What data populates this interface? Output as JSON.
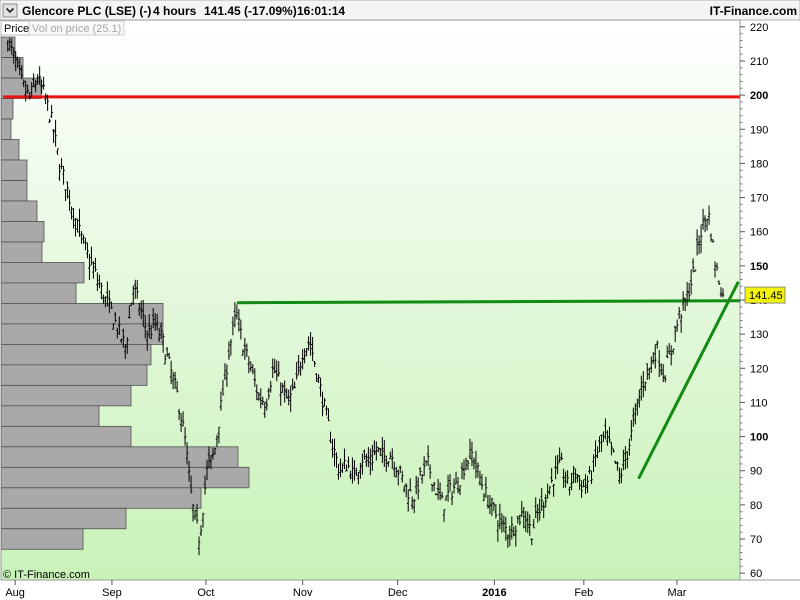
{
  "header": {
    "title": "Glencore PLC (LSE) (-)",
    "period": "4 hours",
    "quote": "141.45 (-17.09%)",
    "time": "16:01:14",
    "brand": "IT-Finance.com"
  },
  "legend": {
    "price_tab": "Price",
    "vol_tab": "Vol on price (25.1)"
  },
  "watermark": "© IT-Finance.com",
  "colors": {
    "plot_top": "#ffffff",
    "plot_bottom": "#c8f2b8",
    "resistance": "#ee1111",
    "support": "#138a13",
    "trend": "#138a13",
    "price_label_bg": "#f2f20a",
    "candle": "#000000",
    "volume_bar": "#a9a9a9"
  },
  "chart_data": {
    "type": "candlestick",
    "title": "Glencore PLC (LSE) (-)",
    "ylim": [
      58,
      222
    ],
    "yticks": [
      60,
      70,
      80,
      90,
      100,
      110,
      120,
      130,
      140,
      150,
      160,
      170,
      180,
      190,
      200,
      210,
      220
    ],
    "ytick_bold": [
      100,
      150,
      200
    ],
    "grid": false,
    "last_price": 141.45,
    "x_axis_labels": [
      {
        "label": "Aug",
        "bold": false
      },
      {
        "label": "Sep",
        "bold": false
      },
      {
        "label": "Oct",
        "bold": false
      },
      {
        "label": "Nov",
        "bold": false
      },
      {
        "label": "Dec",
        "bold": false
      },
      {
        "label": "2016",
        "bold": true
      },
      {
        "label": "Feb",
        "bold": false
      },
      {
        "label": "Mar",
        "bold": false
      }
    ],
    "series": [
      {
        "x": 0,
        "y": 216
      },
      {
        "x": 0.8,
        "y": 210
      },
      {
        "x": 1.6,
        "y": 203
      },
      {
        "x": 2.4,
        "y": 199
      },
      {
        "x": 3.2,
        "y": 205
      },
      {
        "x": 4,
        "y": 200
      },
      {
        "x": 4.8,
        "y": 192
      },
      {
        "x": 5.6,
        "y": 180
      },
      {
        "x": 6.4,
        "y": 173
      },
      {
        "x": 7.2,
        "y": 165
      },
      {
        "x": 8,
        "y": 158
      },
      {
        "x": 8.8,
        "y": 152
      },
      {
        "x": 9.6,
        "y": 147
      },
      {
        "x": 10.4,
        "y": 141
      },
      {
        "x": 11.2,
        "y": 137
      },
      {
        "x": 12,
        "y": 131
      },
      {
        "x": 12.8,
        "y": 126
      },
      {
        "x": 13.6,
        "y": 144
      },
      {
        "x": 14.4,
        "y": 137
      },
      {
        "x": 15.2,
        "y": 130
      },
      {
        "x": 16,
        "y": 133
      },
      {
        "x": 16.8,
        "y": 128
      },
      {
        "x": 17.6,
        "y": 120
      },
      {
        "x": 18.4,
        "y": 112
      },
      {
        "x": 19.2,
        "y": 100
      },
      {
        "x": 20,
        "y": 80
      },
      {
        "x": 20.8,
        "y": 70
      },
      {
        "x": 21.6,
        "y": 90
      },
      {
        "x": 22.4,
        "y": 95
      },
      {
        "x": 23.2,
        "y": 110
      },
      {
        "x": 24,
        "y": 125
      },
      {
        "x": 24.8,
        "y": 136
      },
      {
        "x": 25.6,
        "y": 126
      },
      {
        "x": 26.4,
        "y": 120
      },
      {
        "x": 27.2,
        "y": 112
      },
      {
        "x": 28,
        "y": 110
      },
      {
        "x": 28.8,
        "y": 120
      },
      {
        "x": 29.6,
        "y": 115
      },
      {
        "x": 30.4,
        "y": 110
      },
      {
        "x": 31.2,
        "y": 114
      },
      {
        "x": 32,
        "y": 125
      },
      {
        "x": 32.8,
        "y": 128
      },
      {
        "x": 33.6,
        "y": 118
      },
      {
        "x": 34.4,
        "y": 108
      },
      {
        "x": 35.2,
        "y": 98
      },
      {
        "x": 36,
        "y": 90
      },
      {
        "x": 36.8,
        "y": 92
      },
      {
        "x": 37.6,
        "y": 88
      },
      {
        "x": 38.4,
        "y": 94
      },
      {
        "x": 39.2,
        "y": 92
      },
      {
        "x": 40,
        "y": 96
      },
      {
        "x": 40.8,
        "y": 94
      },
      {
        "x": 41.6,
        "y": 95
      },
      {
        "x": 42.4,
        "y": 90
      },
      {
        "x": 43.2,
        "y": 85
      },
      {
        "x": 44,
        "y": 82
      },
      {
        "x": 44.8,
        "y": 88
      },
      {
        "x": 45.6,
        "y": 92
      },
      {
        "x": 46.4,
        "y": 85
      },
      {
        "x": 47.2,
        "y": 80
      },
      {
        "x": 48,
        "y": 84
      },
      {
        "x": 48.8,
        "y": 86
      },
      {
        "x": 49.6,
        "y": 92
      },
      {
        "x": 50.4,
        "y": 95
      },
      {
        "x": 51.2,
        "y": 88
      },
      {
        "x": 52,
        "y": 82
      },
      {
        "x": 52.8,
        "y": 78
      },
      {
        "x": 53.6,
        "y": 74
      },
      {
        "x": 54.4,
        "y": 72
      },
      {
        "x": 55.2,
        "y": 75
      },
      {
        "x": 56,
        "y": 78
      },
      {
        "x": 56.8,
        "y": 72
      },
      {
        "x": 57.6,
        "y": 78
      },
      {
        "x": 58.4,
        "y": 83
      },
      {
        "x": 59.2,
        "y": 88
      },
      {
        "x": 60,
        "y": 92
      },
      {
        "x": 60.8,
        "y": 85
      },
      {
        "x": 61.6,
        "y": 90
      },
      {
        "x": 62.4,
        "y": 85
      },
      {
        "x": 63.2,
        "y": 88
      },
      {
        "x": 64,
        "y": 96
      },
      {
        "x": 64.8,
        "y": 100
      },
      {
        "x": 65.6,
        "y": 95
      },
      {
        "x": 66.4,
        "y": 88
      },
      {
        "x": 67.2,
        "y": 95
      },
      {
        "x": 68,
        "y": 105
      },
      {
        "x": 68.8,
        "y": 115
      },
      {
        "x": 69.6,
        "y": 120
      },
      {
        "x": 70.4,
        "y": 126
      },
      {
        "x": 71.2,
        "y": 118
      },
      {
        "x": 72,
        "y": 125
      },
      {
        "x": 72.8,
        "y": 135
      },
      {
        "x": 73.6,
        "y": 140
      },
      {
        "x": 74.4,
        "y": 148
      },
      {
        "x": 75.2,
        "y": 160
      },
      {
        "x": 76,
        "y": 166
      },
      {
        "x": 76.8,
        "y": 150
      },
      {
        "x": 77.6,
        "y": 141.45
      }
    ],
    "volume_profile": [
      {
        "price": 214,
        "size": 14
      },
      {
        "price": 208,
        "size": 22
      },
      {
        "price": 202,
        "size": 40
      },
      {
        "price": 196,
        "size": 12
      },
      {
        "price": 190,
        "size": 10
      },
      {
        "price": 184,
        "size": 18
      },
      {
        "price": 178,
        "size": 26
      },
      {
        "price": 172,
        "size": 26
      },
      {
        "price": 166,
        "size": 36
      },
      {
        "price": 160,
        "size": 43
      },
      {
        "price": 154,
        "size": 41
      },
      {
        "price": 148,
        "size": 83
      },
      {
        "price": 142,
        "size": 75
      },
      {
        "price": 136,
        "size": 162
      },
      {
        "price": 130,
        "size": 162
      },
      {
        "price": 124,
        "size": 150
      },
      {
        "price": 118,
        "size": 146
      },
      {
        "price": 112,
        "size": 130
      },
      {
        "price": 106,
        "size": 98
      },
      {
        "price": 100,
        "size": 130
      },
      {
        "price": 94,
        "size": 237
      },
      {
        "price": 88,
        "size": 248
      },
      {
        "price": 82,
        "size": 200
      },
      {
        "price": 76,
        "size": 125
      },
      {
        "price": 70,
        "size": 82
      }
    ],
    "annotations": [
      {
        "type": "hline",
        "y": 199.5,
        "color": "#ee1111",
        "from_x": -0.5,
        "to_x": 81.5
      },
      {
        "type": "segment",
        "x1": 25,
        "y1": 139.2,
        "x2": 79.8,
        "y2": 139.8,
        "color": "#138a13"
      },
      {
        "type": "segment",
        "x1": 68.5,
        "y1": 88,
        "x2": 79.2,
        "y2": 145,
        "color": "#138a13"
      }
    ],
    "x_tick_positions": [
      0.8,
      11.3,
      21.5,
      32,
      42.3,
      52.8,
      62.5,
      72.6
    ],
    "xlim": [
      -0.3,
      77.6
    ]
  }
}
